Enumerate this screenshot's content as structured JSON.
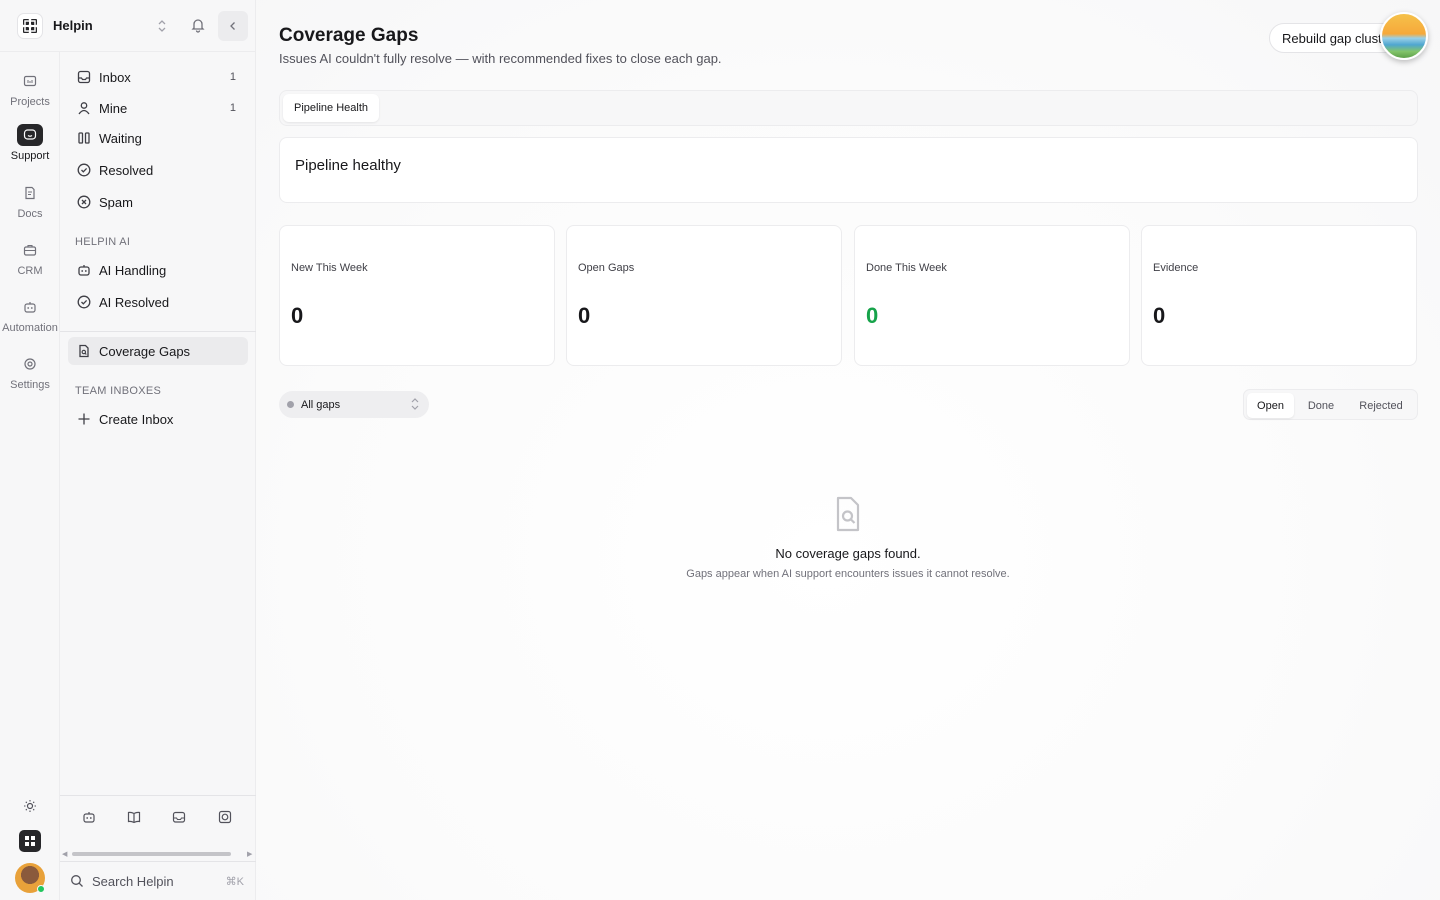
{
  "workspace": {
    "name": "Helpin"
  },
  "rail": {
    "items": [
      {
        "label": "Projects",
        "icon": "folder-icon"
      },
      {
        "label": "Support",
        "icon": "chat-icon",
        "active": true
      },
      {
        "label": "Docs",
        "icon": "doc-icon"
      },
      {
        "label": "CRM",
        "icon": "briefcase-icon"
      },
      {
        "label": "Automation",
        "icon": "bot-icon"
      },
      {
        "label": "Settings",
        "icon": "gear-icon"
      }
    ]
  },
  "nav": {
    "inbox": {
      "label": "Inbox",
      "count": "1"
    },
    "mine": {
      "label": "Mine",
      "count": "1"
    },
    "waiting": {
      "label": "Waiting"
    },
    "resolved": {
      "label": "Resolved"
    },
    "spam": {
      "label": "Spam"
    },
    "ai_section": "HELPIN AI",
    "ai_handling": {
      "label": "AI Handling"
    },
    "ai_resolved": {
      "label": "AI Resolved"
    },
    "coverage_gaps": {
      "label": "Coverage Gaps"
    },
    "team_section": "TEAM INBOXES",
    "create_inbox": {
      "label": "Create Inbox"
    },
    "search": {
      "placeholder": "Search Helpin",
      "shortcut": "⌘K"
    }
  },
  "page": {
    "title": "Coverage Gaps",
    "subtitle": "Issues AI couldn't fully resolve — with recommended fixes to close each gap.",
    "rebuild_label": "Rebuild gap clusters",
    "tab_label": "Pipeline Health",
    "health_title": "Pipeline healthy",
    "stats": [
      {
        "label": "New This Week",
        "value": "0"
      },
      {
        "label": "Open Gaps",
        "value": "0"
      },
      {
        "label": "Done This Week",
        "value": "0"
      },
      {
        "label": "Evidence",
        "value": "0"
      }
    ],
    "filter": {
      "selected": "All gaps"
    },
    "segments": [
      "Open",
      "Done",
      "Rejected"
    ],
    "empty": {
      "title": "No coverage gaps found.",
      "subtitle": "Gaps appear when AI support encounters issues it cannot resolve."
    }
  },
  "colors": {
    "success": "#16a34a",
    "active_rail": "#27272a"
  }
}
